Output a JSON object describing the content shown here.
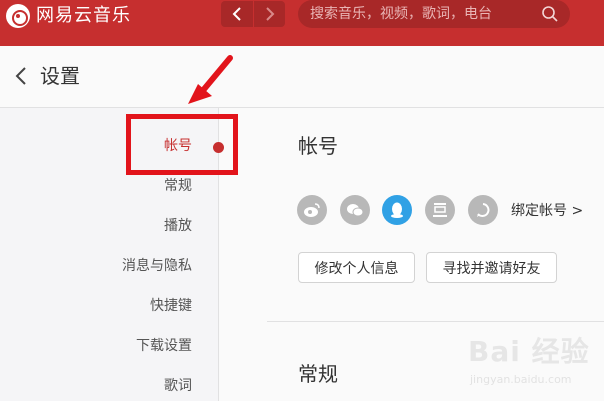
{
  "app": {
    "name": "网易云音乐"
  },
  "search": {
    "placeholder": "搜索音乐，视频，歌词，电台"
  },
  "header": {
    "title": "设置"
  },
  "sidebar": {
    "items": [
      {
        "label": "帐号"
      },
      {
        "label": "常规"
      },
      {
        "label": "播放"
      },
      {
        "label": "消息与隐私"
      },
      {
        "label": "快捷键"
      },
      {
        "label": "下载设置"
      },
      {
        "label": "歌词"
      }
    ],
    "active_index": 0
  },
  "content": {
    "account_title": "帐号",
    "bind_label": "绑定帐号 >",
    "social_icons": [
      "weibo-icon",
      "wechat-icon",
      "qq-icon",
      "douban-icon",
      "yixin-icon"
    ],
    "buttons": {
      "edit_profile": "修改个人信息",
      "invite_friends": "寻找并邀请好友"
    },
    "general_title": "常规"
  },
  "watermark": {
    "text": "Bai 经验",
    "url": "jingyan.baidu.com"
  },
  "colors": {
    "brand": "#c62f2f",
    "annotation": "#e2141b",
    "qq": "#30a1e5"
  }
}
